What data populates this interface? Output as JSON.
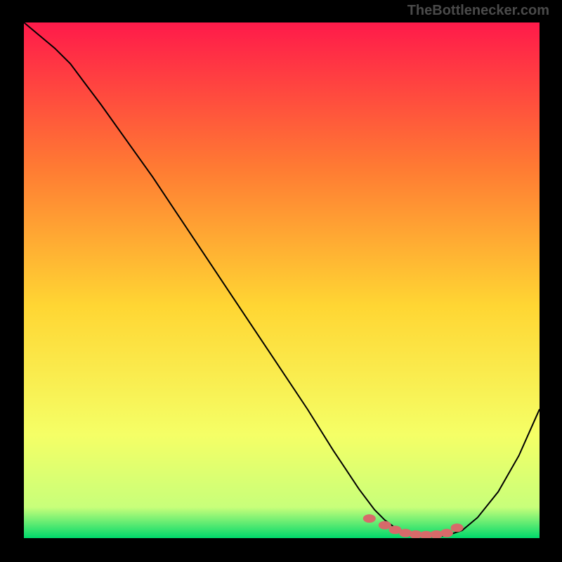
{
  "watermark": "TheBottlenecker.com",
  "chart_data": {
    "type": "line",
    "title": "",
    "xlabel": "",
    "ylabel": "",
    "xlim": [
      0,
      100
    ],
    "ylim": [
      0,
      100
    ],
    "background_gradient": {
      "top": "#ff1a4a",
      "upper_mid": "#ff7a33",
      "mid": "#ffd633",
      "lower_mid": "#f5ff66",
      "near_bottom": "#c8ff7a",
      "bottom": "#00d96b"
    },
    "series": [
      {
        "name": "bottleneck-curve",
        "color": "#000000",
        "x": [
          0,
          3,
          6,
          9,
          12,
          15,
          20,
          25,
          30,
          35,
          40,
          45,
          50,
          55,
          60,
          62,
          65,
          68,
          70,
          72,
          75,
          78,
          80,
          82,
          85,
          88,
          92,
          96,
          100
        ],
        "y": [
          100,
          97.5,
          95,
          92,
          88,
          84,
          77,
          70,
          62.5,
          55,
          47.5,
          40,
          32.5,
          25,
          17,
          14,
          9.5,
          5.5,
          3.5,
          2,
          0.8,
          0.3,
          0.3,
          0.5,
          1.5,
          4,
          9,
          16,
          25
        ]
      }
    ],
    "markers": {
      "name": "optimal-range-dots",
      "color": "#d76a6a",
      "x": [
        67,
        70,
        72,
        74,
        76,
        78,
        80,
        82,
        84
      ],
      "y": [
        3.8,
        2.5,
        1.6,
        1.0,
        0.7,
        0.6,
        0.7,
        1.0,
        2.0
      ]
    }
  }
}
